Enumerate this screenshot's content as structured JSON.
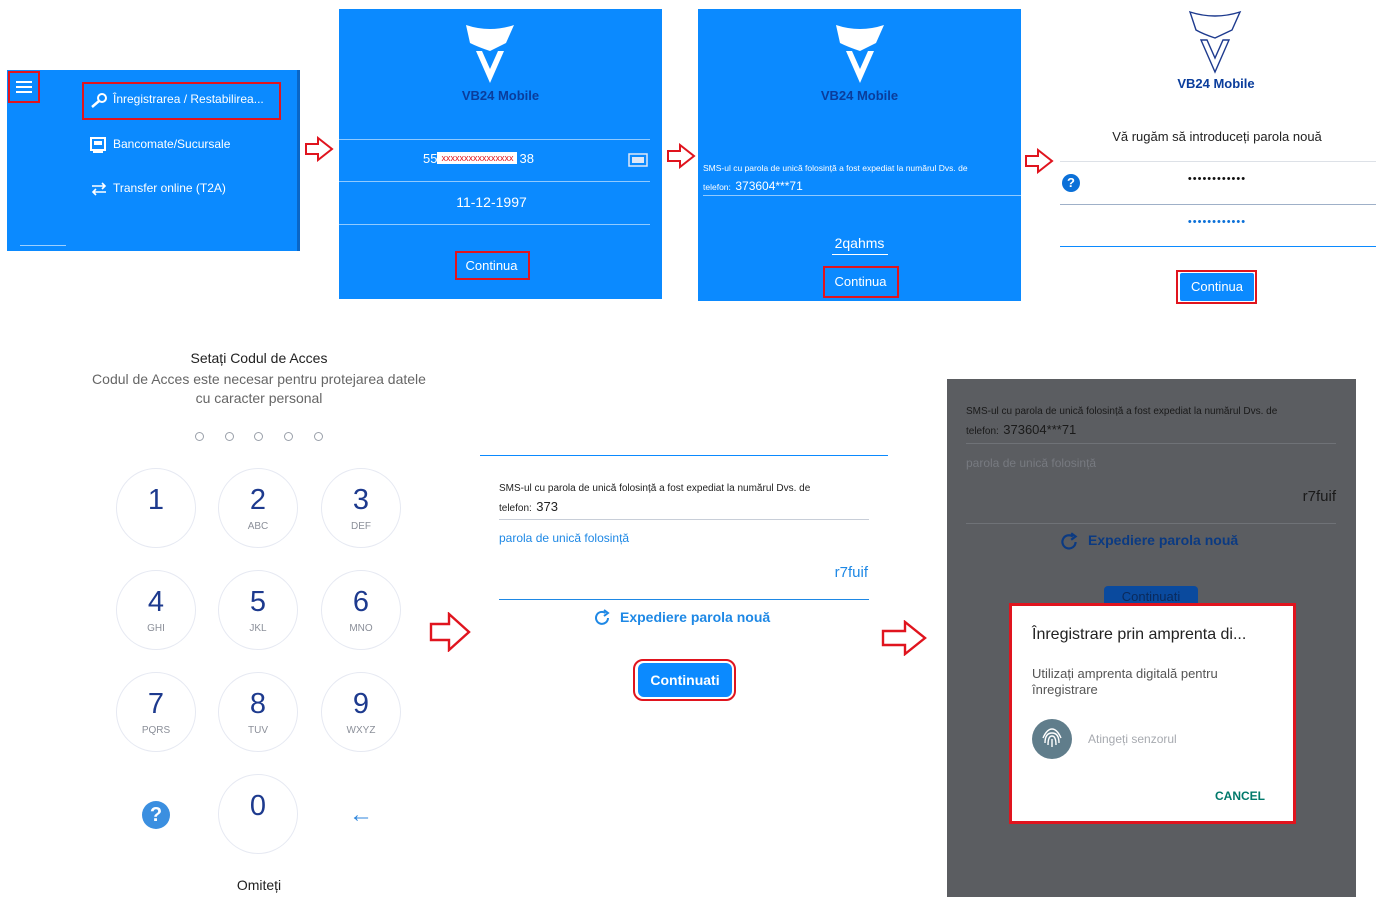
{
  "menu": {
    "items": [
      {
        "label": "Înregistrarea / Restabilirea...",
        "icon": "key-icon"
      },
      {
        "label": "Bancomate/Sucursale",
        "icon": "atm-icon"
      },
      {
        "label": "Transfer online (T2A)",
        "icon": "transfer-icon"
      }
    ]
  },
  "screen2": {
    "app_name": "VB24 Mobile",
    "card_prefix": "55",
    "card_masked": "xxxxxxxxxxxxxxxx",
    "card_suffix": "38",
    "birthdate": "11-12-1997",
    "button": "Continua"
  },
  "screen3": {
    "app_name": "VB24 Mobile",
    "sms_text": "SMS-ul cu parola de unică folosință a fost expediat la numărul Dvs. de",
    "phone_label": "telefon:",
    "phone": "373604***71",
    "otp": "2qahms",
    "button": "Continua"
  },
  "screen4": {
    "app_name": "VB24 Mobile",
    "prompt": "Vă rugăm să introduceți parola nouă",
    "password1": "••••••••••••",
    "password2": "••••••••••••",
    "help": "?",
    "button": "Continua"
  },
  "screen5": {
    "title": "Setați Codul de Acces",
    "subtitle1": "Codul de Acces este necesar pentru protejarea datele",
    "subtitle2": "cu caracter personal",
    "keys": [
      {
        "d": "1",
        "l": ""
      },
      {
        "d": "2",
        "l": "ABC"
      },
      {
        "d": "3",
        "l": "DEF"
      },
      {
        "d": "4",
        "l": "GHI"
      },
      {
        "d": "5",
        "l": "JKL"
      },
      {
        "d": "6",
        "l": "MNO"
      },
      {
        "d": "7",
        "l": "PQRS"
      },
      {
        "d": "8",
        "l": "TUV"
      },
      {
        "d": "9",
        "l": "WXYZ"
      },
      {
        "d": "0",
        "l": ""
      }
    ],
    "help": "?",
    "back": "←",
    "skip": "Omiteți"
  },
  "screen6": {
    "sms_text": "SMS-ul cu parola de unică folosință a fost expediat la numărul Dvs. de",
    "phone_label": "telefon:",
    "phone": "373",
    "otp_label": "parola de unică folosință",
    "otp": "r7fuif",
    "resend": "Expediere parola nouă",
    "button": "Continuati"
  },
  "screen7": {
    "sms_text": "SMS-ul cu parola de unică folosință a fost expediat la numărul Dvs. de",
    "phone_label": "telefon:",
    "phone": "373604***71",
    "otp_label": "parola de unică folosință",
    "otp": "r7fuif",
    "resend": "Expediere parola nouă",
    "button_partial": "Continuati",
    "dialog": {
      "title": "Înregistrare prin amprenta di...",
      "body1": "Utilizați amprenta digitală pentru",
      "body2": "înregistrare",
      "sensor": "Atingeți senzorul",
      "cancel": "CANCEL"
    }
  },
  "colors": {
    "accent": "#0b8aff",
    "highlight": "#e0141e",
    "dark_blue": "#1d3a8e"
  }
}
